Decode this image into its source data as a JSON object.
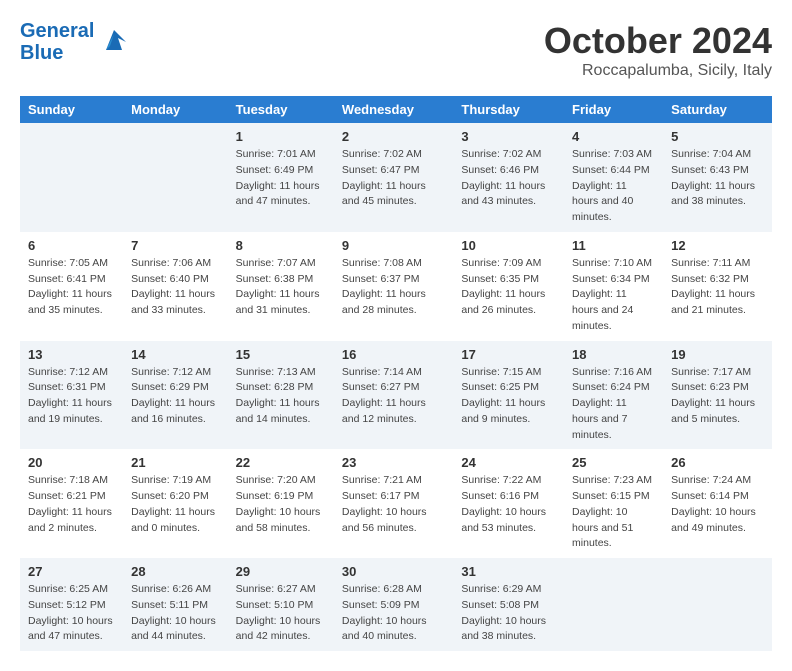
{
  "header": {
    "logo_line1": "General",
    "logo_line2": "Blue",
    "month_title": "October 2024",
    "location": "Roccapalumba, Sicily, Italy"
  },
  "weekdays": [
    "Sunday",
    "Monday",
    "Tuesday",
    "Wednesday",
    "Thursday",
    "Friday",
    "Saturday"
  ],
  "weeks": [
    [
      {
        "day": "",
        "info": ""
      },
      {
        "day": "",
        "info": ""
      },
      {
        "day": "1",
        "info": "Sunrise: 7:01 AM\nSunset: 6:49 PM\nDaylight: 11 hours and 47 minutes."
      },
      {
        "day": "2",
        "info": "Sunrise: 7:02 AM\nSunset: 6:47 PM\nDaylight: 11 hours and 45 minutes."
      },
      {
        "day": "3",
        "info": "Sunrise: 7:02 AM\nSunset: 6:46 PM\nDaylight: 11 hours and 43 minutes."
      },
      {
        "day": "4",
        "info": "Sunrise: 7:03 AM\nSunset: 6:44 PM\nDaylight: 11 hours and 40 minutes."
      },
      {
        "day": "5",
        "info": "Sunrise: 7:04 AM\nSunset: 6:43 PM\nDaylight: 11 hours and 38 minutes."
      }
    ],
    [
      {
        "day": "6",
        "info": "Sunrise: 7:05 AM\nSunset: 6:41 PM\nDaylight: 11 hours and 35 minutes."
      },
      {
        "day": "7",
        "info": "Sunrise: 7:06 AM\nSunset: 6:40 PM\nDaylight: 11 hours and 33 minutes."
      },
      {
        "day": "8",
        "info": "Sunrise: 7:07 AM\nSunset: 6:38 PM\nDaylight: 11 hours and 31 minutes."
      },
      {
        "day": "9",
        "info": "Sunrise: 7:08 AM\nSunset: 6:37 PM\nDaylight: 11 hours and 28 minutes."
      },
      {
        "day": "10",
        "info": "Sunrise: 7:09 AM\nSunset: 6:35 PM\nDaylight: 11 hours and 26 minutes."
      },
      {
        "day": "11",
        "info": "Sunrise: 7:10 AM\nSunset: 6:34 PM\nDaylight: 11 hours and 24 minutes."
      },
      {
        "day": "12",
        "info": "Sunrise: 7:11 AM\nSunset: 6:32 PM\nDaylight: 11 hours and 21 minutes."
      }
    ],
    [
      {
        "day": "13",
        "info": "Sunrise: 7:12 AM\nSunset: 6:31 PM\nDaylight: 11 hours and 19 minutes."
      },
      {
        "day": "14",
        "info": "Sunrise: 7:12 AM\nSunset: 6:29 PM\nDaylight: 11 hours and 16 minutes."
      },
      {
        "day": "15",
        "info": "Sunrise: 7:13 AM\nSunset: 6:28 PM\nDaylight: 11 hours and 14 minutes."
      },
      {
        "day": "16",
        "info": "Sunrise: 7:14 AM\nSunset: 6:27 PM\nDaylight: 11 hours and 12 minutes."
      },
      {
        "day": "17",
        "info": "Sunrise: 7:15 AM\nSunset: 6:25 PM\nDaylight: 11 hours and 9 minutes."
      },
      {
        "day": "18",
        "info": "Sunrise: 7:16 AM\nSunset: 6:24 PM\nDaylight: 11 hours and 7 minutes."
      },
      {
        "day": "19",
        "info": "Sunrise: 7:17 AM\nSunset: 6:23 PM\nDaylight: 11 hours and 5 minutes."
      }
    ],
    [
      {
        "day": "20",
        "info": "Sunrise: 7:18 AM\nSunset: 6:21 PM\nDaylight: 11 hours and 2 minutes."
      },
      {
        "day": "21",
        "info": "Sunrise: 7:19 AM\nSunset: 6:20 PM\nDaylight: 11 hours and 0 minutes."
      },
      {
        "day": "22",
        "info": "Sunrise: 7:20 AM\nSunset: 6:19 PM\nDaylight: 10 hours and 58 minutes."
      },
      {
        "day": "23",
        "info": "Sunrise: 7:21 AM\nSunset: 6:17 PM\nDaylight: 10 hours and 56 minutes."
      },
      {
        "day": "24",
        "info": "Sunrise: 7:22 AM\nSunset: 6:16 PM\nDaylight: 10 hours and 53 minutes."
      },
      {
        "day": "25",
        "info": "Sunrise: 7:23 AM\nSunset: 6:15 PM\nDaylight: 10 hours and 51 minutes."
      },
      {
        "day": "26",
        "info": "Sunrise: 7:24 AM\nSunset: 6:14 PM\nDaylight: 10 hours and 49 minutes."
      }
    ],
    [
      {
        "day": "27",
        "info": "Sunrise: 6:25 AM\nSunset: 5:12 PM\nDaylight: 10 hours and 47 minutes."
      },
      {
        "day": "28",
        "info": "Sunrise: 6:26 AM\nSunset: 5:11 PM\nDaylight: 10 hours and 44 minutes."
      },
      {
        "day": "29",
        "info": "Sunrise: 6:27 AM\nSunset: 5:10 PM\nDaylight: 10 hours and 42 minutes."
      },
      {
        "day": "30",
        "info": "Sunrise: 6:28 AM\nSunset: 5:09 PM\nDaylight: 10 hours and 40 minutes."
      },
      {
        "day": "31",
        "info": "Sunrise: 6:29 AM\nSunset: 5:08 PM\nDaylight: 10 hours and 38 minutes."
      },
      {
        "day": "",
        "info": ""
      },
      {
        "day": "",
        "info": ""
      }
    ]
  ]
}
